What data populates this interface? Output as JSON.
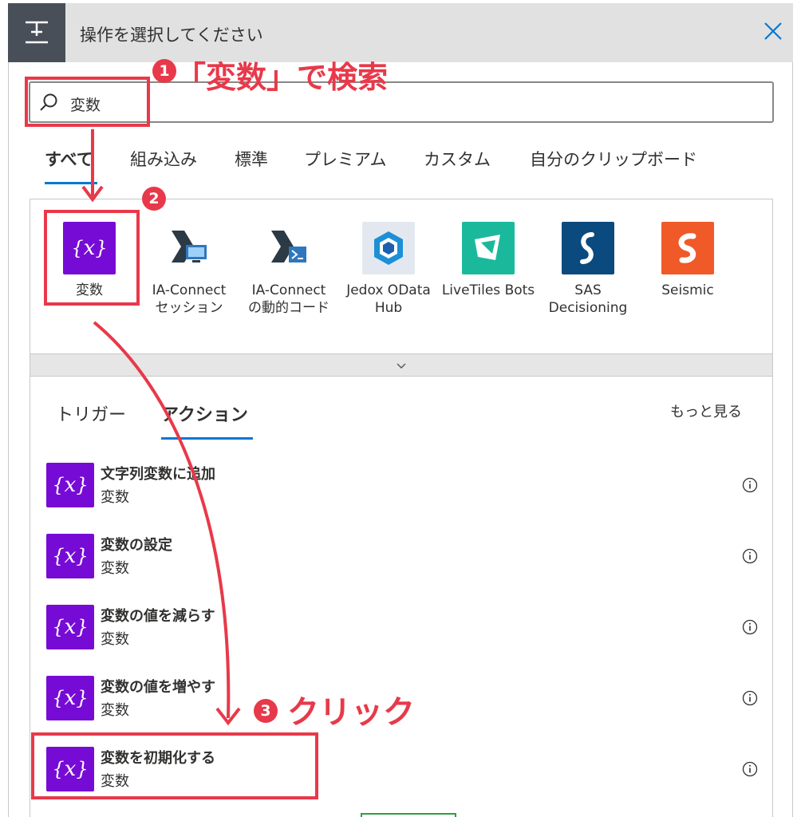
{
  "dialog": {
    "title": "操作を選択してください"
  },
  "search": {
    "value": "変数"
  },
  "filter_tabs": [
    {
      "label": "すべて"
    },
    {
      "label": "組み込み"
    },
    {
      "label": "標準"
    },
    {
      "label": "プレミアム"
    },
    {
      "label": "カスタム"
    },
    {
      "label": "自分のクリップボード"
    }
  ],
  "connectors": [
    {
      "line1": "変数",
      "line2": "",
      "icon": "variable-icon",
      "color": "#770bd6"
    },
    {
      "line1": "IA-Connect",
      "line2": "セッション",
      "icon": "ia-connect-session-icon",
      "color": "#ffffff"
    },
    {
      "line1": "IA-Connect",
      "line2": "の動的コード",
      "icon": "ia-connect-dynamic-code-icon",
      "color": "#ffffff"
    },
    {
      "line1": "Jedox OData",
      "line2": "Hub",
      "icon": "jedox-icon",
      "color": "#e3e8f0"
    },
    {
      "line1": "LiveTiles Bots",
      "line2": "",
      "icon": "livetiles-icon",
      "color": "#1ab99c"
    },
    {
      "line1": "SAS",
      "line2": "Decisioning",
      "icon": "sas-icon",
      "color": "#0b4a7e"
    },
    {
      "line1": "Seismic",
      "line2": "",
      "icon": "seismic-icon",
      "color": "#f05a28"
    }
  ],
  "sub_tabs": [
    {
      "label": "トリガー"
    },
    {
      "label": "アクション"
    }
  ],
  "more_label": "もっと見る",
  "actions": [
    {
      "title": "文字列変数に追加",
      "subtitle": "変数"
    },
    {
      "title": "変数の設定",
      "subtitle": "変数"
    },
    {
      "title": "変数の値を減らす",
      "subtitle": "変数"
    },
    {
      "title": "変数の値を増やす",
      "subtitle": "変数"
    },
    {
      "title": "変数を初期化する",
      "subtitle": "変数"
    }
  ],
  "annotations": {
    "step1": "「変数」で検索",
    "step3": "クリック",
    "badge1": "1",
    "badge2": "2",
    "badge3": "3"
  },
  "colors": {
    "accent": "#0078d4",
    "annotation": "#e8394a",
    "variable": "#770bd6"
  }
}
